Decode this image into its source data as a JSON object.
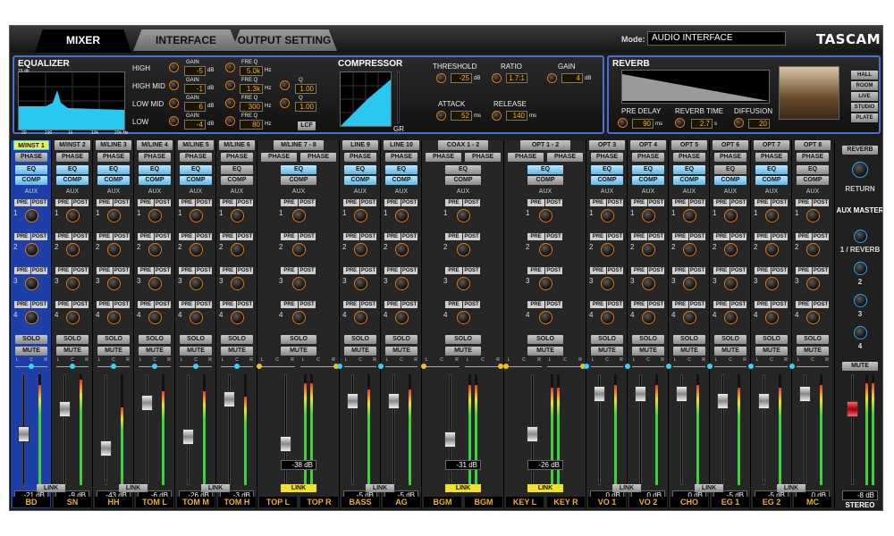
{
  "tabs": [
    "MIXER",
    "INTERFACE",
    "OUTPUT SETTING"
  ],
  "mode": {
    "label": "Mode:",
    "value": "AUDIO INTERFACE"
  },
  "brand": "TASCAM",
  "equalizer": {
    "title": "EQUALIZER",
    "graph_ticks": {
      "db_top": "15 db",
      "x": [
        "20",
        "100",
        "1k",
        "10k",
        "20k Hz"
      ]
    },
    "gain_label": "GAIN",
    "freq_label": "FRE Q",
    "q_label": "Q",
    "db_unit": "dB",
    "hz_unit": "Hz",
    "bands": [
      {
        "name": "HIGH",
        "gain": "-5",
        "freq": "5.0k",
        "q": ""
      },
      {
        "name": "HIGH MID",
        "gain": "-1",
        "freq": "1.3k",
        "q": "1.00"
      },
      {
        "name": "LOW MID",
        "gain": "6",
        "freq": "300",
        "q": "1.00"
      },
      {
        "name": "LOW",
        "gain": "-4",
        "freq": "80",
        "q": ""
      }
    ],
    "lcf": "LCF"
  },
  "compressor": {
    "title": "COMPRESSOR",
    "gr": "GR",
    "threshold": {
      "label": "THRESHOLD",
      "value": "-25",
      "unit": "dB"
    },
    "ratio": {
      "label": "RATIO",
      "value": "1.7:1"
    },
    "gain": {
      "label": "GAIN",
      "value": "4",
      "unit": "dB"
    },
    "attack": {
      "label": "ATTACK",
      "value": "52",
      "unit": "ms"
    },
    "release": {
      "label": "RELEASE",
      "value": "140",
      "unit": "ms"
    }
  },
  "reverb": {
    "title": "REVERB",
    "pre_delay": {
      "label": "PRE DELAY",
      "value": "90",
      "unit": "ms"
    },
    "reverb_time": {
      "label": "REVERB TIME",
      "value": "2.7",
      "unit": "s"
    },
    "diffusion": {
      "label": "DIFFUSION",
      "value": "20"
    },
    "types": [
      "HALL",
      "ROOM",
      "LIVE",
      "STUDIO",
      "PLATE"
    ],
    "selected_type": "HALL"
  },
  "strip_labels": {
    "phase": "PHASE",
    "eq": "EQ",
    "comp": "COMP",
    "aux": "AUX",
    "pre": "PRE",
    "post": "POST",
    "solo": "SOLO",
    "mute": "MUTE",
    "link": "LINK",
    "lcr": [
      "L",
      "C",
      "R"
    ]
  },
  "channels": [
    {
      "name": "M/INST 1",
      "label": "BD",
      "db": "-21 dB",
      "fader": 0.45,
      "meter": 0.9,
      "pan": 0.5,
      "eq": true,
      "comp": true,
      "sel": true
    },
    {
      "name": "M/INST 2",
      "label": "SN",
      "db": "-9 dB",
      "fader": 0.72,
      "meter": 0.95,
      "pan": 0.5,
      "eq": true,
      "comp": true
    },
    {
      "name": "M/LINE 3",
      "label": "HH",
      "db": "-43 dB",
      "fader": 0.3,
      "meter": 0.7,
      "pan": 0.5,
      "eq": true,
      "comp": true
    },
    {
      "name": "M/LINE 4",
      "label": "TOM L",
      "db": "-6 dB",
      "fader": 0.78,
      "meter": 0.85,
      "pan": 0.5,
      "eq": true,
      "comp": true
    },
    {
      "name": "M/LINE 5",
      "label": "TOM M",
      "db": "-26 dB",
      "fader": 0.42,
      "meter": 0.85,
      "pan": 0.5,
      "eq": true,
      "comp": true
    },
    {
      "name": "M/LINE 6",
      "label": "TOM H",
      "db": "-3 dB",
      "fader": 0.82,
      "meter": 0.8,
      "pan": 0.5,
      "eq": false,
      "comp": false
    }
  ],
  "stereo_channels": [
    {
      "name": "M/LINE 7 - 8",
      "labels": [
        "TOP L",
        "TOP R"
      ],
      "db": "-38 dB",
      "fader": 0.35,
      "meter": 0.92,
      "eq": true,
      "comp": false,
      "link_on": true
    },
    {
      "name": "COAX 1 - 2",
      "labels": [
        "BGM",
        "BGM"
      ],
      "db": "-31 dB",
      "fader": 0.4,
      "meter": 0.9,
      "eq": false,
      "comp": false,
      "link_on": true
    },
    {
      "name": "OPT 1 - 2",
      "labels": [
        "KEY L",
        "KEY R"
      ],
      "db": "-26 dB",
      "fader": 0.45,
      "meter": 0.88,
      "eq": true,
      "comp": false,
      "link_on": true
    }
  ],
  "mono_after": [
    {
      "name": "LINE 9",
      "label": "BASS",
      "db": "-5 dB",
      "fader": 0.8,
      "meter": 0.86,
      "eq": true,
      "comp": true
    },
    {
      "name": "LINE 10",
      "label": "AG",
      "db": "-5 dB",
      "fader": 0.8,
      "meter": 0.86,
      "eq": true,
      "comp": true
    }
  ],
  "opt_channels": [
    {
      "name": "OPT 3",
      "label": "VO 1",
      "db": "0 dB",
      "fader": 0.88,
      "meter": 0.9,
      "eq": true,
      "comp": true
    },
    {
      "name": "OPT 4",
      "label": "VO 2",
      "db": "0 dB",
      "fader": 0.88,
      "meter": 0.9,
      "eq": true,
      "comp": true
    },
    {
      "name": "OPT 5",
      "label": "CHO",
      "db": "0 dB",
      "fader": 0.88,
      "meter": 0.9,
      "eq": true,
      "comp": true
    },
    {
      "name": "OPT 6",
      "label": "EG 1",
      "db": "-5 dB",
      "fader": 0.8,
      "meter": 0.88,
      "eq": false,
      "comp": true
    },
    {
      "name": "OPT 7",
      "label": "EG 2",
      "db": "-5 dB",
      "fader": 0.8,
      "meter": 0.88,
      "eq": true,
      "comp": true
    },
    {
      "name": "OPT 8",
      "label": "MC",
      "db": "0 dB",
      "fader": 0.88,
      "meter": 0.9,
      "eq": false,
      "comp": false
    }
  ],
  "master": {
    "reverb": "REVERB",
    "return": "RETURN",
    "aux_master": "AUX MASTER",
    "aux_names": [
      "1 / REVERB",
      "2",
      "3",
      "4"
    ],
    "mute": "MUTE",
    "db": "-8 dB",
    "stereo_master": "STEREO MASTER",
    "fader": 0.72,
    "meter": 0.92
  }
}
